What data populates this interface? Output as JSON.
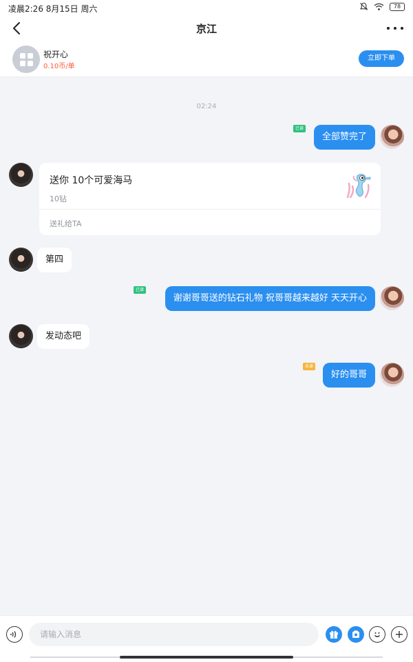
{
  "status_bar": {
    "time_date": "凌晨2:26 8月15日 周六",
    "battery": "78"
  },
  "nav": {
    "title": "京江"
  },
  "service": {
    "name": "祝开心",
    "price": "0.10币/单",
    "order_button": "立即下单"
  },
  "chat": {
    "timestamp": "02:24",
    "messages": [
      {
        "side": "out",
        "text": "全部赞完了",
        "read": "已读"
      },
      {
        "side": "in",
        "type": "gift",
        "title": "送你 10个可爱海马",
        "price": "10钻",
        "link": "送礼给TA"
      },
      {
        "side": "in",
        "text": "第四"
      },
      {
        "side": "out",
        "text": "谢谢哥哥送的钻石礼物 祝哥哥越来越好 天天开心",
        "read": "已读"
      },
      {
        "side": "in",
        "text": "发动态吧"
      },
      {
        "side": "out",
        "text": "好的哥哥",
        "read": "未读"
      }
    ]
  },
  "input_bar": {
    "placeholder": "请输入消息"
  },
  "colors": {
    "accent": "#2b8ff0",
    "read_green": "#2ec27e",
    "unread_orange": "#f5b63c",
    "price_red": "#ff5a3c",
    "background": "#f3f4f8"
  },
  "icons": [
    "back-arrow-icon",
    "more-dots-icon",
    "voice-icon",
    "gift-icon",
    "coupon-icon",
    "emoji-icon",
    "plus-icon",
    "mute-bell-icon",
    "wifi-icon",
    "battery-icon"
  ]
}
